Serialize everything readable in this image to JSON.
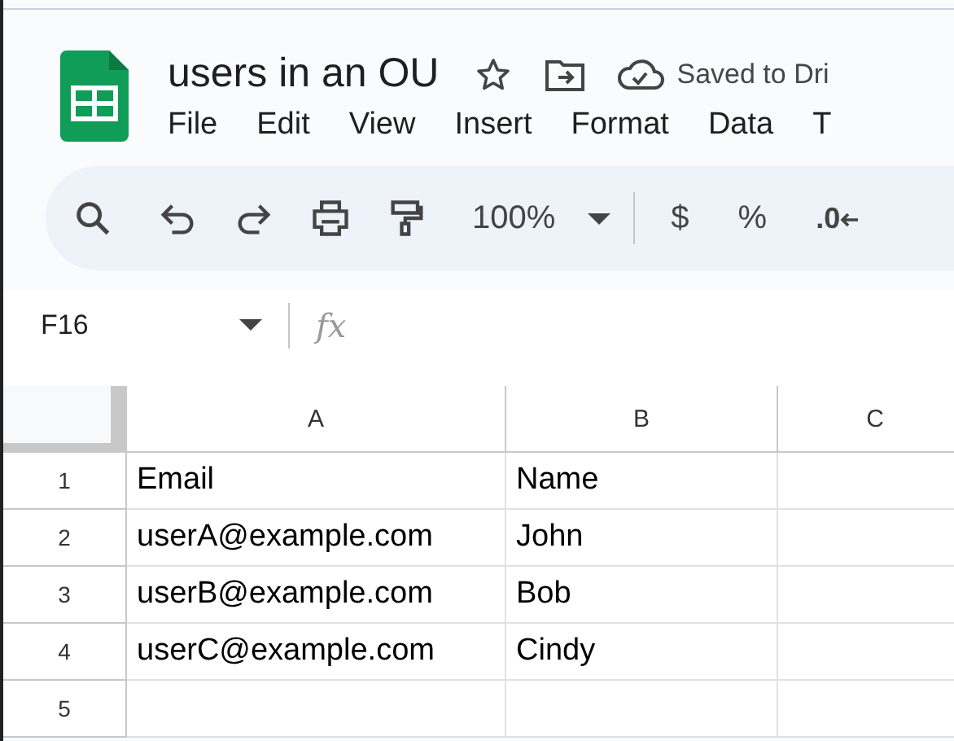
{
  "document": {
    "title": "users in an OU",
    "save_status": "Saved to Dri"
  },
  "menu": [
    "File",
    "Edit",
    "View",
    "Insert",
    "Format",
    "Data",
    "T"
  ],
  "toolbar": {
    "zoom": "100%",
    "currency": "$",
    "percent": "%",
    "decimal": ".0"
  },
  "formula_bar": {
    "cell_reference": "F16",
    "fx_label": "fx"
  },
  "sheet": {
    "columns": [
      "A",
      "B",
      "C"
    ],
    "rows": [
      {
        "number": "1",
        "cells": [
          "Email",
          "Name",
          ""
        ]
      },
      {
        "number": "2",
        "cells": [
          "userA@example.com",
          "John",
          ""
        ]
      },
      {
        "number": "3",
        "cells": [
          "userB@example.com",
          "Bob",
          ""
        ]
      },
      {
        "number": "4",
        "cells": [
          "userC@example.com",
          "Cindy",
          ""
        ]
      },
      {
        "number": "5",
        "cells": [
          "",
          "",
          ""
        ]
      }
    ]
  }
}
